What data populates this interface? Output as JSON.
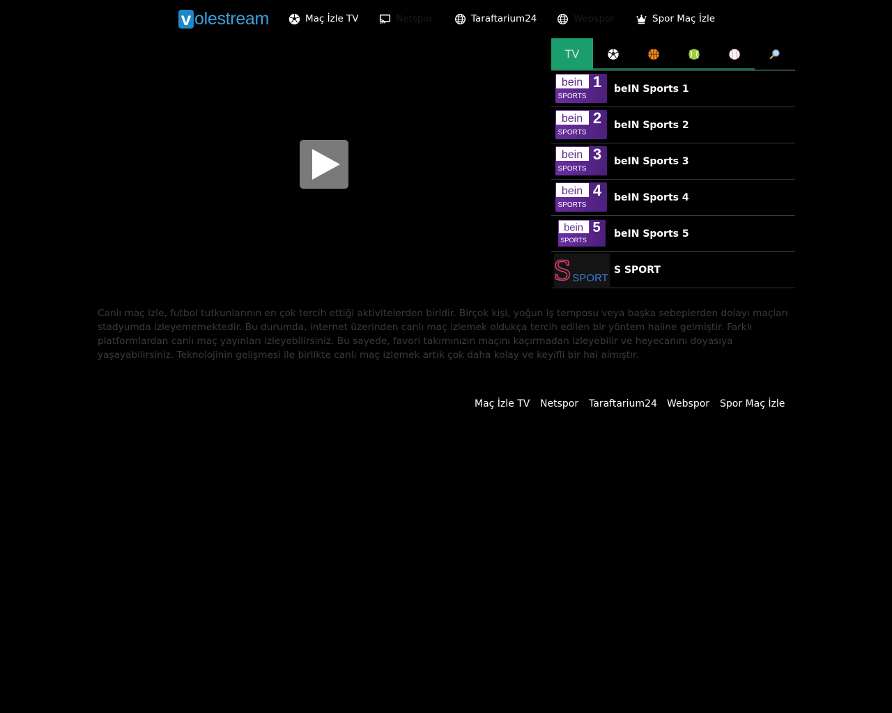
{
  "logo": {
    "v": "v",
    "text": "olestream"
  },
  "nav": [
    {
      "label": "Maç İzle TV",
      "icon": "soccer-ball-icon"
    },
    {
      "label": "Netspor",
      "icon": "cast-icon"
    },
    {
      "label": "Taraftarium24",
      "icon": "globe-icon"
    },
    {
      "label": "Webspor",
      "icon": "globe-icon"
    },
    {
      "label": "Spor Maç İzle",
      "icon": "crown-icon"
    }
  ],
  "tabs": [
    {
      "label": "TV",
      "icon": ""
    },
    {
      "label": "",
      "icon": "soccer-ball-icon"
    },
    {
      "label": "",
      "icon": "basketball-icon"
    },
    {
      "label": "",
      "icon": "tennis-ball-icon"
    },
    {
      "label": "",
      "icon": "baseball-icon"
    },
    {
      "label": "",
      "icon": "search-icon"
    }
  ],
  "channels": [
    {
      "name": "beIN Sports 1",
      "number": "1",
      "logo_word": "bein",
      "logo_sub": "SPORTS"
    },
    {
      "name": "beIN Sports 2",
      "number": "2",
      "logo_word": "bein",
      "logo_sub": "SPORTS"
    },
    {
      "name": "beIN Sports 3",
      "number": "3",
      "logo_word": "bein",
      "logo_sub": "SPORTS"
    },
    {
      "name": "beIN Sports 4",
      "number": "4",
      "logo_word": "bein",
      "logo_sub": "SPORTS"
    },
    {
      "name": "beIN Sports 5",
      "number": "5",
      "logo_word": "bein",
      "logo_sub": "SPORTS"
    },
    {
      "name": "S SPORT",
      "logo_word": "S",
      "logo_sub": "SPORT"
    }
  ],
  "description": "Canlı maç izle, futbol tutkunlarının en çok tercih ettiği aktivitelerden biridir. Birçok kişi, yoğun iş temposu veya başka sebeplerden dolayı maçları stadyumda izleyememektedir. Bu durumda, internet üzerinden canlı maç izlemek oldukça tercih edilen bir yöntem haline gelmiştir. Farklı platformlardan canlı maç yayınları izleyebilirsiniz. Bu sayede, favori takımınızın maçını kaçırmadan izleyebilir ve heyecanını doyasıya yaşayabilirsiniz. Teknolojinin gelişmesi ile birlikte canlı maç izlemek artık çok daha kolay ve keyifli bir hal almıştır.",
  "footer": [
    {
      "label": "Maç İzle TV"
    },
    {
      "label": "Netspor"
    },
    {
      "label": "Taraftarium24"
    },
    {
      "label": "Webspor"
    },
    {
      "label": "Spor Maç İzle"
    }
  ],
  "colors": {
    "accent": "#1a9e6e",
    "bein_purple": "#5b2a86",
    "logo_blue": "#1e88c9"
  }
}
